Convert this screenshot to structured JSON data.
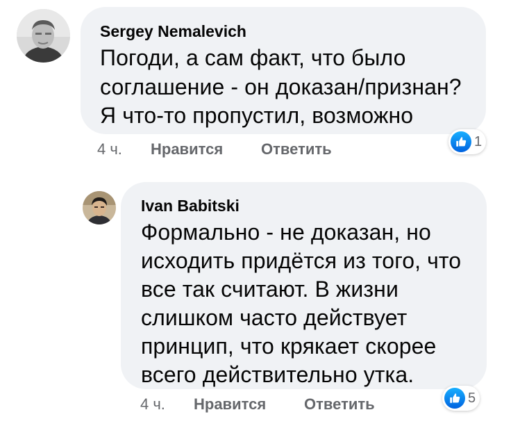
{
  "comments": [
    {
      "author": "Sergey Nemalevich",
      "lines": [
        "Погоди, а сам факт, что было",
        "соглашение - он доказан/признан?",
        "Я что-то пропустил, возможно"
      ],
      "time": "4 ч.",
      "like_label": "Нравится",
      "reply_label": "Ответить",
      "reaction_icon": "like-icon",
      "reaction_count": "1"
    },
    {
      "author": "Ivan Babitski",
      "lines": [
        "Формально - не доказан, но",
        "исходить придётся из того, что",
        "все так считают. В жизни",
        "слишком часто действует",
        "принцип, что крякает скорее",
        "всего действительно утка."
      ],
      "time": "4 ч.",
      "like_label": "Нравится",
      "reply_label": "Ответить",
      "reaction_icon": "like-icon",
      "reaction_count": "5"
    }
  ],
  "colors": {
    "bubble": "#f0f2f5",
    "text": "#050505",
    "meta": "#65676b",
    "like_blue": "#1877f2"
  }
}
